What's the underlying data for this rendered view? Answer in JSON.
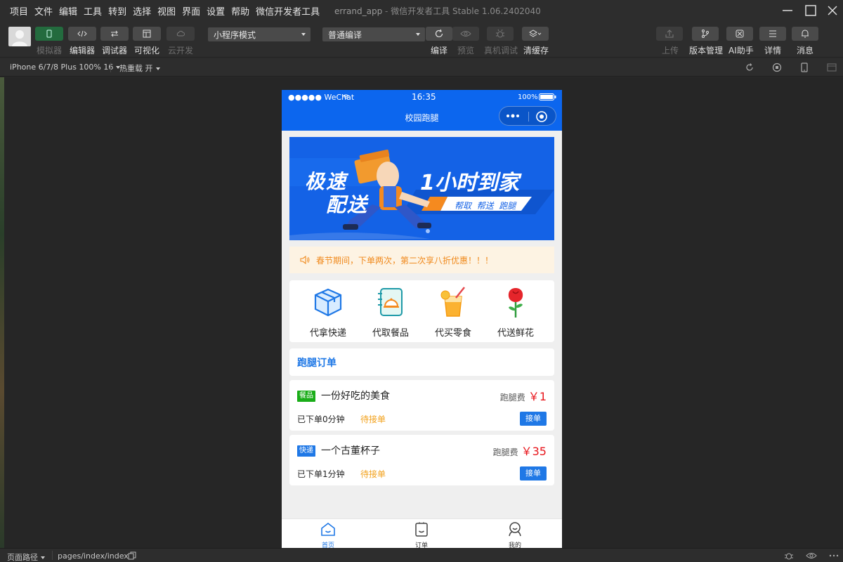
{
  "menubar": {
    "items": [
      "项目",
      "文件",
      "编辑",
      "工具",
      "转到",
      "选择",
      "视图",
      "界面",
      "设置",
      "帮助",
      "微信开发者工具"
    ],
    "window_title": "errand_app",
    "window_subtitle": "微信开发者工具 Stable 1.06.2402040"
  },
  "toolbar": {
    "left_buttons": [
      {
        "label": "模拟器",
        "icon": "phone-icon",
        "state": "active-disabled-label"
      },
      {
        "label": "编辑器",
        "icon": "code-icon"
      },
      {
        "label": "调试器",
        "icon": "debug-icon"
      },
      {
        "label": "可视化",
        "icon": "layout-icon"
      },
      {
        "label": "云开发",
        "icon": "cloud-icon",
        "state": "disabled"
      }
    ],
    "mode_select": "小程序模式",
    "compile_select": "普通编译",
    "actions": [
      {
        "label": "编译",
        "icon": "refresh-icon"
      },
      {
        "label": "预览",
        "icon": "eye-icon",
        "state": "disabled"
      },
      {
        "label": "真机调试",
        "icon": "bug-icon",
        "state": "disabled"
      },
      {
        "label": "清缓存",
        "icon": "layers-icon"
      }
    ],
    "right_actions": [
      {
        "label": "上传",
        "icon": "upload-icon",
        "state": "disabled"
      },
      {
        "label": "版本管理",
        "icon": "branch-icon"
      },
      {
        "label": "AI助手",
        "icon": "ai-icon"
      },
      {
        "label": "详情",
        "icon": "menu-icon"
      },
      {
        "label": "消息",
        "icon": "bell-icon"
      }
    ]
  },
  "subbar": {
    "device": "iPhone 6/7/8 Plus 100% 16",
    "hot_reload": "热重载 开"
  },
  "phone": {
    "status": {
      "carrier": "●●●●● WeChat",
      "time": "16:35",
      "battery": "100%"
    },
    "nav_title": "校园跑腿",
    "banner": {
      "line1": "极速",
      "line2": "配送",
      "headline": "1小时到家",
      "tags": "帮取  帮送  跑腿"
    },
    "notice": "春节期间，下单两次，第二次享八折优惠！！！",
    "services": [
      {
        "label": "代拿快递",
        "icon": "package-icon"
      },
      {
        "label": "代取餐品",
        "icon": "food-cover-icon"
      },
      {
        "label": "代买零食",
        "icon": "drink-icon"
      },
      {
        "label": "代送鲜花",
        "icon": "rose-icon"
      }
    ],
    "section_title": "跑腿订单",
    "orders": [
      {
        "tag": "餐品",
        "tag_color": "#1aad19",
        "title": "一份好吃的美食",
        "fee_label": "跑腿费",
        "fee": "￥1",
        "time": "已下单0分钟",
        "status": "待接单",
        "button": "接单"
      },
      {
        "tag": "快递",
        "tag_color": "#1f78e6",
        "title": "一个古董杯子",
        "fee_label": "跑腿费",
        "fee": "￥35",
        "time": "已下单1分钟",
        "status": "待接单",
        "button": "接单"
      }
    ],
    "tabs": [
      {
        "label": "首页",
        "active": true
      },
      {
        "label": "订单",
        "active": false
      },
      {
        "label": "我的",
        "active": false
      }
    ]
  },
  "bottombar": {
    "path_label": "页面路径",
    "path": "pages/index/index"
  },
  "colors": {
    "brand_blue": "#0c66ee",
    "accent_blue": "#1f78e6",
    "orange": "#f08a1d",
    "red": "#e8161c",
    "green_tag": "#1aad19"
  }
}
